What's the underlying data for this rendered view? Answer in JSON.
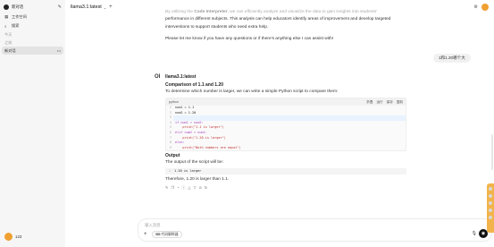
{
  "sidebar": {
    "brand": "新对话",
    "workspace_label": "工作空间",
    "search_label": "搜索",
    "section_today": "今天",
    "section_older": "之前",
    "active_chat": "新对话",
    "user_name": "123"
  },
  "header": {
    "model_name": "llama3.1:latest"
  },
  "previous_message": {
    "line1_pre": "By utilizing the ",
    "line1_bold": "Code Interpreter",
    "line1_post": ", we can efficiently analyze and visualize the data to gain insights into students'",
    "line2": "performance in different subjects. This analysis can help educators identify areas of improvement and develop targeted",
    "line3": "interventions to support students who need extra help.",
    "line4": "Please let me know if you have any questions or if there's anything else I can assist with!"
  },
  "user_message": {
    "text": "1和1.20哪个大"
  },
  "assistant": {
    "avatar_text": "OI",
    "model_name": "llama3.1:latest",
    "heading1": "Comparison of 1.1 and 1.20",
    "intro": "To determine which number is larger, we can write a simple Python script to compare them:",
    "code_lang": "python",
    "code_actions": [
      "折叠",
      "运行",
      "保存",
      "复制"
    ],
    "code_lines": [
      {
        "n": "1",
        "text": "num1 = 1.1"
      },
      {
        "n": "2",
        "text": "num2 = 1.20"
      },
      {
        "n": "3",
        "text": ""
      },
      {
        "n": "4",
        "text": "if num1 > num2:"
      },
      {
        "n": "5",
        "text": "    print(\"1.1 is larger\")"
      },
      {
        "n": "6",
        "text": "elif num2 > num1:"
      },
      {
        "n": "7",
        "text": "    print(\"1.20 is larger\")"
      },
      {
        "n": "8",
        "text": "else:"
      },
      {
        "n": "9",
        "text": "    print(\"Both numbers are equal\")"
      }
    ],
    "heading2": "Output",
    "output_intro": "The output of the script will be:",
    "output_line_no": "1",
    "output_text": "1.20 is larger",
    "conclusion": "Therefore, 1.20 is larger than 1.1."
  },
  "composer": {
    "placeholder": "输入消息",
    "tool_label": "代码解释器"
  }
}
